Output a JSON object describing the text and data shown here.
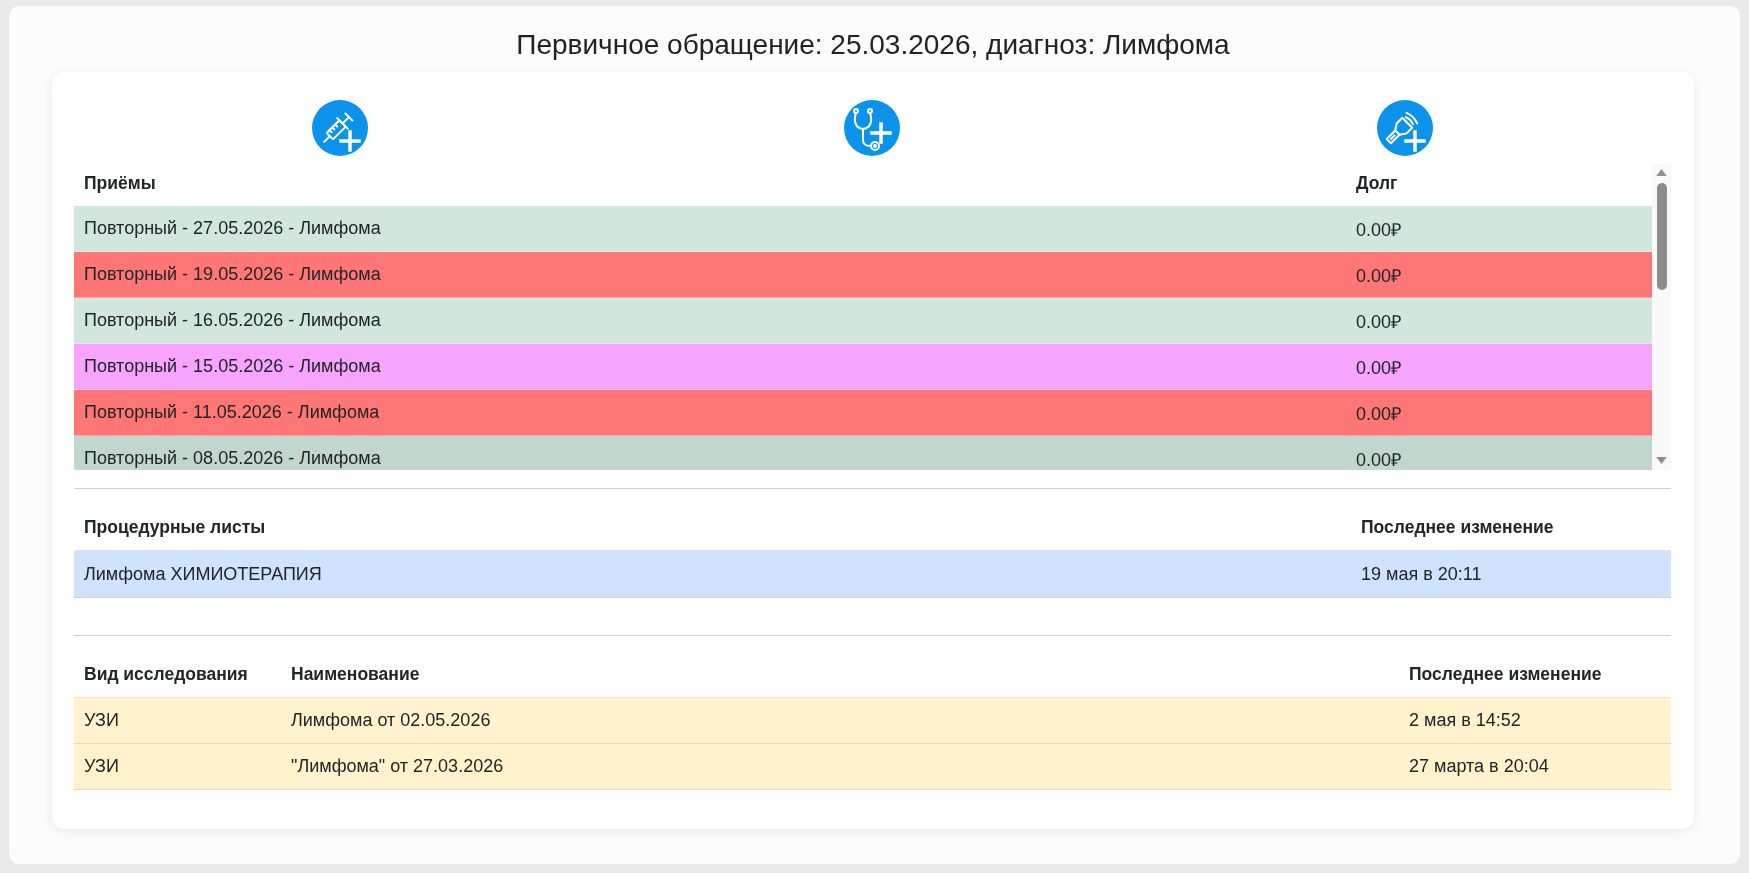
{
  "title": "Первичное обращение: 25.03.2026, диагноз: Лимфома",
  "appointments": {
    "columns": [
      "Приёмы",
      "Долг"
    ],
    "rows": [
      {
        "name": "Повторный - 27.05.2026 - Лимфома",
        "debt": "0.00₽",
        "color": "#d1e7dd"
      },
      {
        "name": "Повторный - 19.05.2026 - Лимфома",
        "debt": "0.00₽",
        "color": "#ff7676"
      },
      {
        "name": "Повторный - 16.05.2026 - Лимфома",
        "debt": "0.00₽",
        "color": "#d1e7dd"
      },
      {
        "name": "Повторный - 15.05.2026 - Лимфома",
        "debt": "0.00₽",
        "color": "#f6a4fe"
      },
      {
        "name": "Повторный - 11.05.2026 - Лимфома",
        "debt": "0.00₽",
        "color": "#ff7676"
      },
      {
        "name": "Повторный - 08.05.2026 - Лимфома",
        "debt": "0.00₽",
        "color": "#c1d6cc"
      }
    ]
  },
  "procedure_sheets": {
    "columns": [
      "Процедурные листы",
      "Последнее изменение"
    ],
    "rows": [
      {
        "name": "Лимфома ХИМИОТЕРАПИЯ",
        "modified": "19 мая в 20:11"
      }
    ]
  },
  "studies": {
    "columns": [
      "Вид исследования",
      "Наименование",
      "Последнее изменение"
    ],
    "rows": [
      {
        "type": "УЗИ",
        "name": "Лимфома от 02.05.2026",
        "modified": "2 мая в 14:52"
      },
      {
        "type": "УЗИ",
        "name": "\"Лимфома\" от 27.03.2026",
        "modified": "27 марта в 20:04"
      }
    ]
  }
}
